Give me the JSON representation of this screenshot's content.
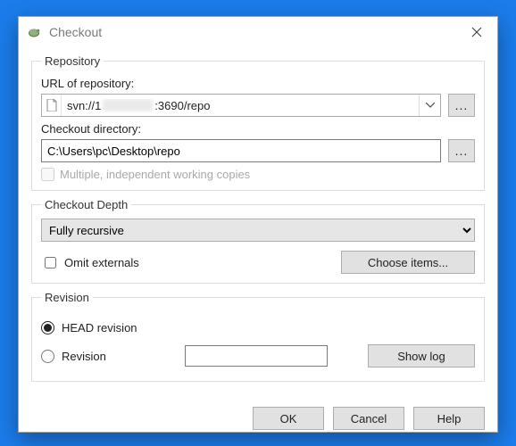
{
  "window": {
    "title": "Checkout"
  },
  "repository": {
    "legend": "Repository",
    "url_label": "URL of repository:",
    "url_prefix": "svn://1",
    "url_suffix": ":3690/repo",
    "dir_label": "Checkout directory:",
    "dir_value": "C:\\Users\\pc\\Desktop\\repo",
    "multiple_label": "Multiple, independent working copies",
    "multiple_checked": false,
    "multiple_enabled": false,
    "browse_dots": "..."
  },
  "depth": {
    "legend": "Checkout Depth",
    "selected": "Fully recursive",
    "omit_label": "Omit externals",
    "omit_checked": false,
    "choose_items_label": "Choose items..."
  },
  "revision": {
    "legend": "Revision",
    "head_label": "HEAD revision",
    "rev_label": "Revision",
    "selected": "head",
    "rev_value": "",
    "show_log_label": "Show log"
  },
  "buttons": {
    "ok": "OK",
    "cancel": "Cancel",
    "help": "Help"
  }
}
